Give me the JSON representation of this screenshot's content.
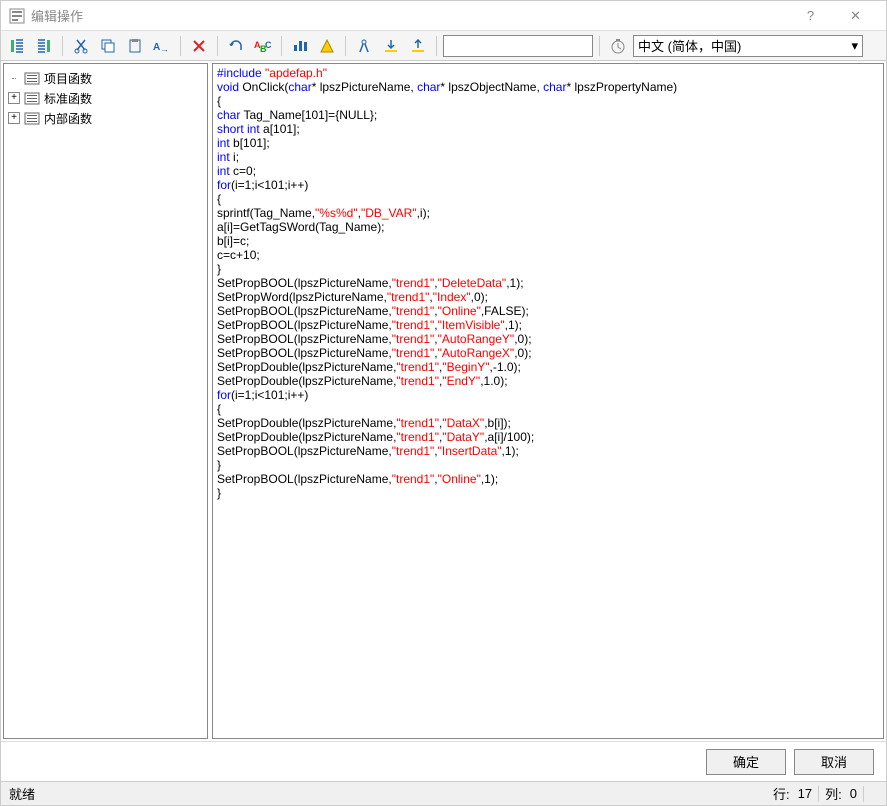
{
  "window": {
    "title": "编辑操作",
    "help": "?",
    "close": "✕"
  },
  "toolbar": {
    "input_placeholder": "",
    "language": "中文 (简体，中国)"
  },
  "tree": {
    "items": [
      {
        "expand": "none",
        "label": "项目函数"
      },
      {
        "expand": "+",
        "label": "标准函数"
      },
      {
        "expand": "+",
        "label": "内部函数"
      }
    ]
  },
  "code": {
    "tokens": [
      [
        {
          "t": "#include ",
          "c": "kw"
        },
        {
          "t": "\"apdefap.h\"",
          "c": "str"
        }
      ],
      [
        {
          "t": "void",
          "c": "kw"
        },
        {
          "t": " OnClick("
        },
        {
          "t": "char",
          "c": "kw"
        },
        {
          "t": "* lpszPictureName, "
        },
        {
          "t": "char",
          "c": "kw"
        },
        {
          "t": "* lpszObjectName, "
        },
        {
          "t": "char",
          "c": "kw"
        },
        {
          "t": "* lpszPropertyName)"
        }
      ],
      [
        {
          "t": "{"
        }
      ],
      [
        {
          "t": "char",
          "c": "kw"
        },
        {
          "t": " Tag_Name[101]={NULL};"
        }
      ],
      [
        {
          "t": "short int",
          "c": "kw"
        },
        {
          "t": " a[101];"
        }
      ],
      [
        {
          "t": "int",
          "c": "kw"
        },
        {
          "t": " b[101];"
        }
      ],
      [
        {
          "t": "int",
          "c": "kw"
        },
        {
          "t": " i;"
        }
      ],
      [
        {
          "t": "int",
          "c": "kw"
        },
        {
          "t": " c=0;"
        }
      ],
      [
        {
          "t": "for",
          "c": "kw"
        },
        {
          "t": "(i=1;i<101;i++)"
        }
      ],
      [
        {
          "t": "{"
        }
      ],
      [
        {
          "t": "sprintf(Tag_Name,"
        },
        {
          "t": "\"%s%d\"",
          "c": "str"
        },
        {
          "t": ","
        },
        {
          "t": "\"DB_VAR\"",
          "c": "str"
        },
        {
          "t": ",i);"
        }
      ],
      [
        {
          "t": "a[i]=GetTagSWord(Tag_Name);"
        }
      ],
      [
        {
          "t": "b[i]=c;"
        }
      ],
      [
        {
          "t": "c=c+10;"
        }
      ],
      [
        {
          "t": "}"
        }
      ],
      [
        {
          "t": "SetPropBOOL(lpszPictureName,"
        },
        {
          "t": "\"trend1\"",
          "c": "str"
        },
        {
          "t": ","
        },
        {
          "t": "\"DeleteData\"",
          "c": "str"
        },
        {
          "t": ",1);"
        }
      ],
      [
        {
          "t": "SetPropWord(lpszPictureName,"
        },
        {
          "t": "\"trend1\"",
          "c": "str"
        },
        {
          "t": ","
        },
        {
          "t": "\"Index\"",
          "c": "str"
        },
        {
          "t": ",0);"
        }
      ],
      [
        {
          "t": "SetPropBOOL(lpszPictureName,"
        },
        {
          "t": "\"trend1\"",
          "c": "str"
        },
        {
          "t": ","
        },
        {
          "t": "\"Online\"",
          "c": "str"
        },
        {
          "t": ",FALSE);"
        }
      ],
      [
        {
          "t": "SetPropBOOL(lpszPictureName,"
        },
        {
          "t": "\"trend1\"",
          "c": "str"
        },
        {
          "t": ","
        },
        {
          "t": "\"ItemVisible\"",
          "c": "str"
        },
        {
          "t": ",1);"
        }
      ],
      [
        {
          "t": "SetPropBOOL(lpszPictureName,"
        },
        {
          "t": "\"trend1\"",
          "c": "str"
        },
        {
          "t": ","
        },
        {
          "t": "\"AutoRangeY\"",
          "c": "str"
        },
        {
          "t": ",0);"
        }
      ],
      [
        {
          "t": "SetPropBOOL(lpszPictureName,"
        },
        {
          "t": "\"trend1\"",
          "c": "str"
        },
        {
          "t": ","
        },
        {
          "t": "\"AutoRangeX\"",
          "c": "str"
        },
        {
          "t": ",0);"
        }
      ],
      [
        {
          "t": "SetPropDouble(lpszPictureName,"
        },
        {
          "t": "\"trend1\"",
          "c": "str"
        },
        {
          "t": ","
        },
        {
          "t": "\"BeginY\"",
          "c": "str"
        },
        {
          "t": ",-1.0);"
        }
      ],
      [
        {
          "t": "SetPropDouble(lpszPictureName,"
        },
        {
          "t": "\"trend1\"",
          "c": "str"
        },
        {
          "t": ","
        },
        {
          "t": "\"EndY\"",
          "c": "str"
        },
        {
          "t": ",1.0);"
        }
      ],
      [
        {
          "t": "for",
          "c": "kw"
        },
        {
          "t": "(i=1;i<101;i++)"
        }
      ],
      [
        {
          "t": "{"
        }
      ],
      [
        {
          "t": "SetPropDouble(lpszPictureName,"
        },
        {
          "t": "\"trend1\"",
          "c": "str"
        },
        {
          "t": ","
        },
        {
          "t": "\"DataX\"",
          "c": "str"
        },
        {
          "t": ",b[i]);"
        }
      ],
      [
        {
          "t": "SetPropDouble(lpszPictureName,"
        },
        {
          "t": "\"trend1\"",
          "c": "str"
        },
        {
          "t": ","
        },
        {
          "t": "\"DataY\"",
          "c": "str"
        },
        {
          "t": ",a[i]/100);"
        }
      ],
      [
        {
          "t": "SetPropBOOL(lpszPictureName,"
        },
        {
          "t": "\"trend1\"",
          "c": "str"
        },
        {
          "t": ","
        },
        {
          "t": "\"InsertData\"",
          "c": "str"
        },
        {
          "t": ",1);"
        }
      ],
      [
        {
          "t": "}"
        }
      ],
      [
        {
          "t": "SetPropBOOL(lpszPictureName,"
        },
        {
          "t": "\"trend1\"",
          "c": "str"
        },
        {
          "t": ","
        },
        {
          "t": "\"Online\"",
          "c": "str"
        },
        {
          "t": ",1);"
        }
      ],
      [
        {
          "t": "}"
        }
      ]
    ]
  },
  "buttons": {
    "ok": "确定",
    "cancel": "取消"
  },
  "status": {
    "ready": "就绪",
    "line_label": "行:",
    "line_value": "17",
    "col_label": "列:",
    "col_value": "0"
  }
}
